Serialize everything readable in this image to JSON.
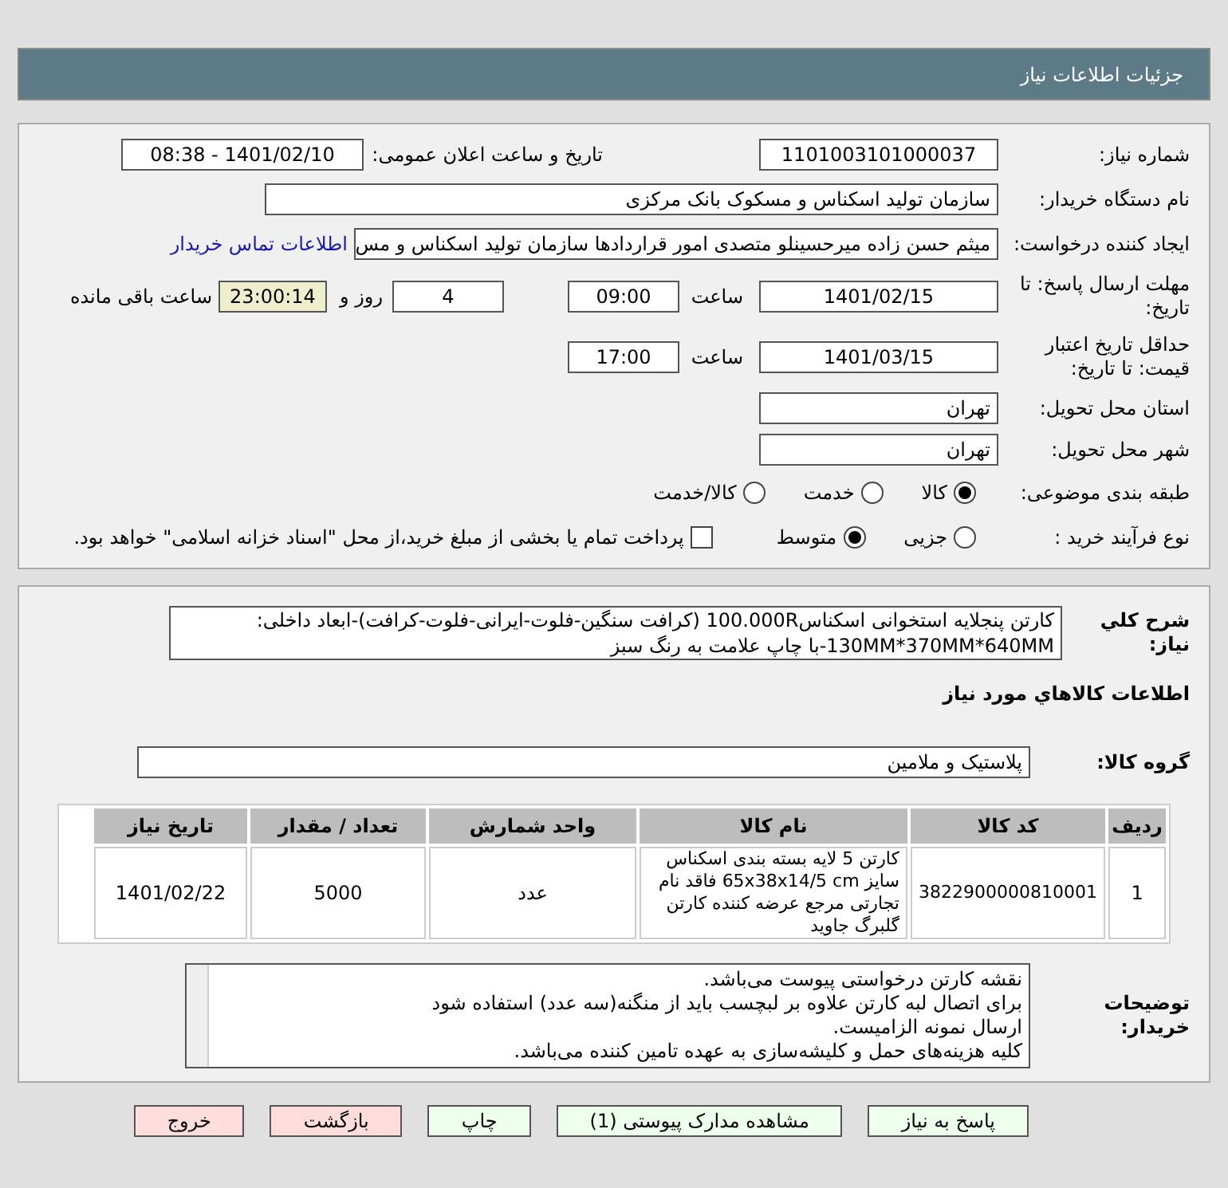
{
  "header": {
    "title": "جزئیات اطلاعات نیاز"
  },
  "details": {
    "need_number": {
      "label": "شماره نیاز:",
      "value": "1101003101000037"
    },
    "announce": {
      "label": "تاریخ و ساعت اعلان عمومی:",
      "value": "1401/02/10 - 08:38"
    },
    "buyer": {
      "label": "نام دستگاه خریدار:",
      "value": "سازمان تولید اسکناس و مسکوک بانک مرکزی"
    },
    "requester": {
      "label": "ایجاد کننده درخواست:",
      "value": "میثم حسن زاده میرحسینلو متصدی امور قراردادها سازمان تولید اسکناس و مس",
      "link": "اطلاعات تماس خریدار"
    },
    "deadline": {
      "label": "مهلت ارسال پاسخ: تا تاریخ:",
      "date": "1401/02/15",
      "time_label": "ساعت",
      "time": "09:00",
      "days": "4",
      "days_label": "روز و",
      "remaining": "23:00:14",
      "remaining_label": "ساعت باقی مانده"
    },
    "validity": {
      "label": "حداقل تاریخ اعتبار قیمت: تا تاریخ:",
      "date": "1401/03/15",
      "time_label": "ساعت",
      "time": "17:00"
    },
    "province": {
      "label": "استان محل تحویل:",
      "value": "تهران"
    },
    "city": {
      "label": "شهر محل تحویل:",
      "value": "تهران"
    },
    "category": {
      "label": "طبقه بندی موضوعی:",
      "options": [
        {
          "label": "کالا",
          "selected": true
        },
        {
          "label": "خدمت",
          "selected": false
        },
        {
          "label": "کالا/خدمت",
          "selected": false
        }
      ]
    },
    "process": {
      "label": "نوع فرآیند خرید :",
      "options": [
        {
          "label": "جزیی",
          "selected": false
        },
        {
          "label": "متوسط",
          "selected": true
        }
      ],
      "treasury": {
        "label": "پرداخت تمام یا بخشی از مبلغ خرید،از محل \"اسناد خزانه اسلامی\" خواهد بود.",
        "checked": false
      }
    }
  },
  "need": {
    "description": {
      "label": "شرح کلي نياز:",
      "value": "کارتن پنجلایه استخوانی اسکناس100.000R (کرافت سنگین-فلوت-ایرانی-فلوت-کرافت)-ابعاد داخلی: 130MM*370MM*640MM-با چاپ علامت به رنگ سبز"
    },
    "goods_heading": "اطلاعات کالاهاي مورد نياز",
    "group": {
      "label": "گروه کالا:",
      "value": "پلاستیک و ملامین"
    },
    "table": {
      "columns": [
        "ردیف",
        "کد کالا",
        "نام کالا",
        "واحد شمارش",
        "تعداد / مقدار",
        "تاریخ نیاز"
      ],
      "rows": [
        [
          "1",
          "3822900000810001",
          "کارتن 5 لایه بسته بندی اسکناس سایز 65x38x14/5 cm فاقد نام تجارتی مرجع عرضه کننده کارتن گلبرگ جاوید",
          "عدد",
          "5000",
          "1401/02/22"
        ]
      ]
    },
    "notes": {
      "label": "توضیحات خریدار:",
      "lines": [
        "نقشه کارتن درخواستی پیوست می‌باشد.",
        "برای اتصال لبه کارتن علاوه بر لبچسب باید از منگنه(سه عدد) استفاده شود",
        "ارسال نمونه الزامیست.",
        "کلیه هزینه‌های حمل و کلیشه‌سازی به عهده تامین کننده می‌باشد."
      ]
    }
  },
  "buttons": [
    {
      "label": "پاسخ به نیاز",
      "kind": "go"
    },
    {
      "label": "مشاهده مدارک پیوستی (1)",
      "kind": "go"
    },
    {
      "label": "چاپ",
      "kind": "go"
    },
    {
      "label": "بازگشت",
      "kind": "stop"
    },
    {
      "label": "خروج",
      "kind": "stop"
    }
  ]
}
